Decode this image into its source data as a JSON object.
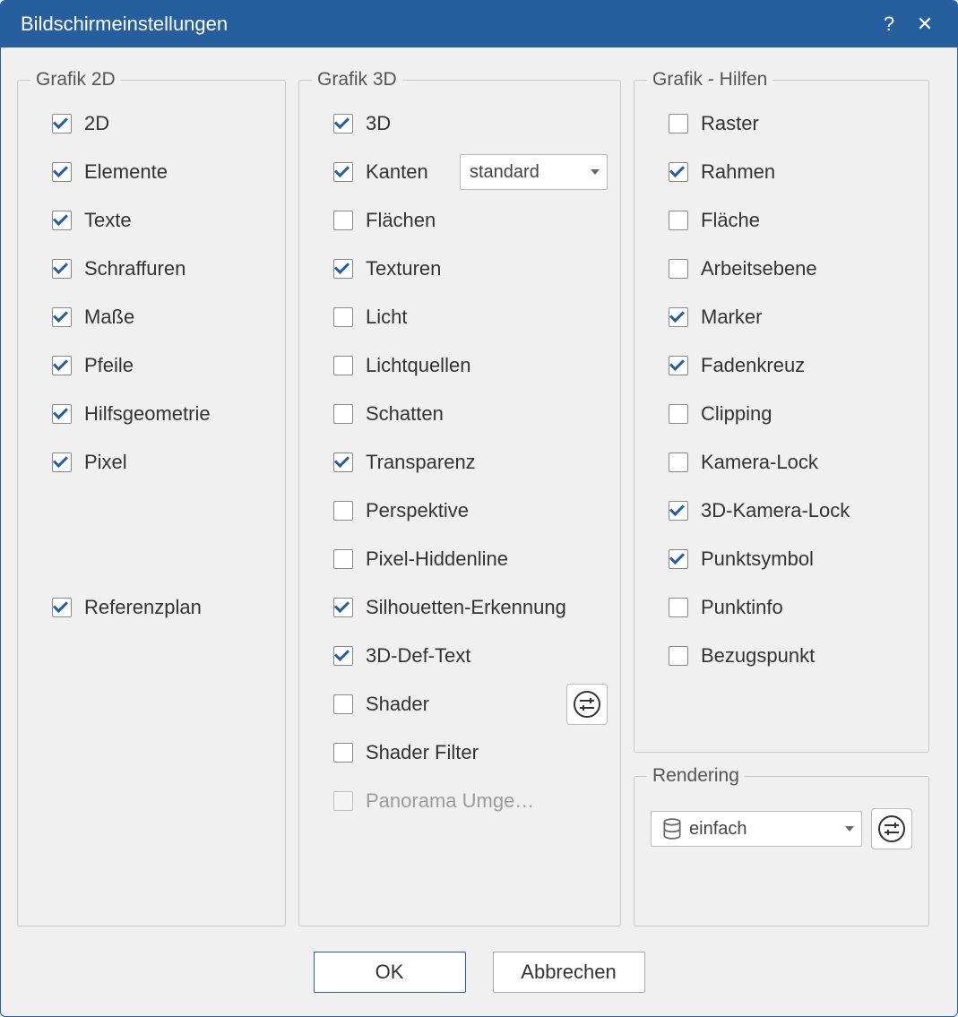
{
  "title": "Bildschirmeinstellungen",
  "groups": {
    "g2d": {
      "legend": "Grafik 2D",
      "items": {
        "d2d": {
          "label": "2D",
          "checked": true
        },
        "elemente": {
          "label": "Elemente",
          "checked": true
        },
        "texte": {
          "label": "Texte",
          "checked": true
        },
        "schraffuren": {
          "label": "Schraffuren",
          "checked": true
        },
        "masse": {
          "label": "Maße",
          "checked": true
        },
        "pfeile": {
          "label": "Pfeile",
          "checked": true
        },
        "hilfsgeometrie": {
          "label": "Hilfsgeometrie",
          "checked": true
        },
        "pixel": {
          "label": "Pixel",
          "checked": true
        },
        "referenzplan": {
          "label": "Referenzplan",
          "checked": true
        }
      }
    },
    "g3d": {
      "legend": "Grafik 3D",
      "items": {
        "d3d": {
          "label": "3D",
          "checked": true
        },
        "kanten": {
          "label": "Kanten",
          "checked": true,
          "select": "standard"
        },
        "flaechen": {
          "label": "Flächen",
          "checked": false
        },
        "texturen": {
          "label": "Texturen",
          "checked": true
        },
        "licht": {
          "label": "Licht",
          "checked": false
        },
        "lichtquellen": {
          "label": "Lichtquellen",
          "checked": false
        },
        "schatten": {
          "label": "Schatten",
          "checked": false
        },
        "transparenz": {
          "label": "Transparenz",
          "checked": true
        },
        "perspektive": {
          "label": "Perspektive",
          "checked": false
        },
        "pixelhidden": {
          "label": "Pixel-Hiddenline",
          "checked": false
        },
        "silhouetten": {
          "label": "Silhouetten-Erkennung",
          "checked": true
        },
        "deftext": {
          "label": "3D-Def-Text",
          "checked": true
        },
        "shader": {
          "label": "Shader",
          "checked": false
        },
        "shaderfilter": {
          "label": "Shader Filter",
          "checked": false
        },
        "panorama": {
          "label": "Panorama Umge…",
          "checked": false,
          "disabled": true
        }
      }
    },
    "hilfen": {
      "legend": "Grafik - Hilfen",
      "items": {
        "raster": {
          "label": "Raster",
          "checked": false
        },
        "rahmen": {
          "label": "Rahmen",
          "checked": true
        },
        "flaeche": {
          "label": "Fläche",
          "checked": false
        },
        "arbeitsebene": {
          "label": "Arbeitsebene",
          "checked": false
        },
        "marker": {
          "label": "Marker",
          "checked": true
        },
        "fadenkreuz": {
          "label": "Fadenkreuz",
          "checked": true
        },
        "clipping": {
          "label": "Clipping",
          "checked": false
        },
        "kameralock": {
          "label": "Kamera-Lock",
          "checked": false
        },
        "kameralock3d": {
          "label": "3D-Kamera-Lock",
          "checked": true
        },
        "punktsymbol": {
          "label": "Punktsymbol",
          "checked": true
        },
        "punktinfo": {
          "label": "Punktinfo",
          "checked": false
        },
        "bezugspunkt": {
          "label": "Bezugspunkt",
          "checked": false
        }
      }
    },
    "rendering": {
      "legend": "Rendering",
      "mode": "einfach"
    }
  },
  "buttons": {
    "ok": "OK",
    "cancel": "Abbrechen"
  }
}
